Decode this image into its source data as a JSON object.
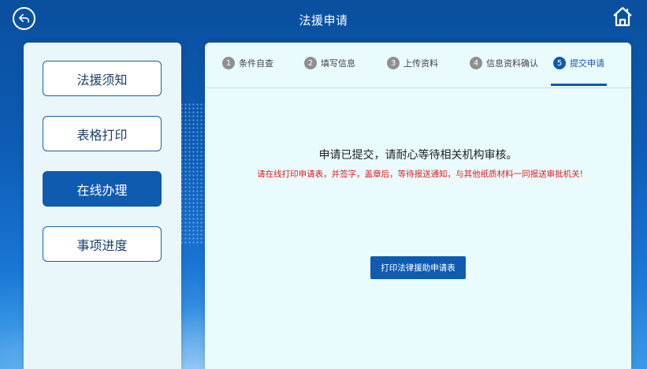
{
  "header": {
    "title": "法援申请",
    "back_icon": "back-arrow-icon",
    "home_icon": "home-icon"
  },
  "sidebar": {
    "items": [
      {
        "label": "法援须知",
        "active": false
      },
      {
        "label": "表格打印",
        "active": false
      },
      {
        "label": "在线办理",
        "active": true
      },
      {
        "label": "事项进度",
        "active": false
      }
    ]
  },
  "steps": [
    {
      "num": "1",
      "label": "条件自查"
    },
    {
      "num": "2",
      "label": "填写信息"
    },
    {
      "num": "3",
      "label": "上传资料"
    },
    {
      "num": "4",
      "label": "信息资料确认"
    },
    {
      "num": "5",
      "label": "提交申请"
    }
  ],
  "content": {
    "message": "申请已提交，请耐心等待相关机构审核。",
    "notice": "请在线打印申请表，并签字，盖章后，等待报送通知，与其他纸质材料一同报送审批机关!",
    "print_button": "打印法律援助申请表"
  },
  "colors": {
    "primary": "#0f5bb0",
    "notice": "#e02020"
  }
}
